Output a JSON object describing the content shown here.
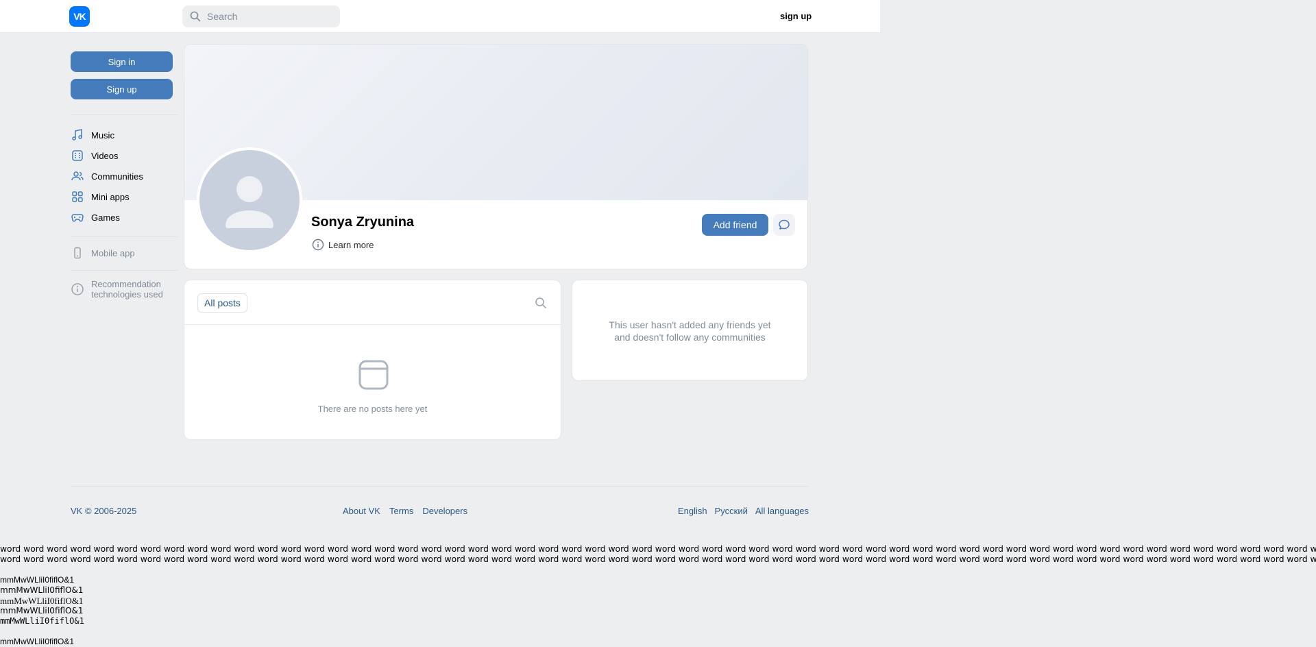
{
  "header": {
    "logo": "VK",
    "search_placeholder": "Search",
    "signup_label": "sign up"
  },
  "sidebar": {
    "sign_in": "Sign in",
    "sign_up": "Sign up",
    "items": [
      {
        "label": "Music",
        "icon": "music-note-icon"
      },
      {
        "label": "Videos",
        "icon": "video-icon"
      },
      {
        "label": "Communities",
        "icon": "users-icon"
      },
      {
        "label": "Mini apps",
        "icon": "apps-grid-icon"
      },
      {
        "label": "Games",
        "icon": "gamepad-icon"
      }
    ],
    "mobile_app": "Mobile app",
    "recommendation_line1": "Recommendation",
    "recommendation_line2": "technologies used"
  },
  "profile": {
    "name": "Sonya Zryunina",
    "learn_more": "Learn more",
    "add_friend": "Add friend"
  },
  "posts": {
    "tab_label": "All posts",
    "empty_text": "There are no posts here yet"
  },
  "friends": {
    "empty_line1": "This user hasn't added any friends yet",
    "empty_line2": "and doesn't follow any communities"
  },
  "footer": {
    "copyright": "VK © 2006-2025",
    "links": [
      "About VK",
      "Terms",
      "Developers"
    ],
    "languages": [
      "English",
      "Русский",
      "All languages"
    ]
  },
  "test_text": {
    "word_line": "word word word word word word word word word word word word word word word word word word word word word word word word word word word word word word word word word word word word word word word word word word word word word word word word word word word word word word word word word word word word word word",
    "glyph_lines": [
      "mmMwWLliI0fiflO&1",
      "mmMwWLliI0fiflO&1",
      "mmMwWLliI0fiflO&1",
      "mmMwWLliI0fiflO&1",
      "mmMwWLliI0fiflO&1",
      "",
      "mmMwWLliI0fiflO&1"
    ]
  }
}
